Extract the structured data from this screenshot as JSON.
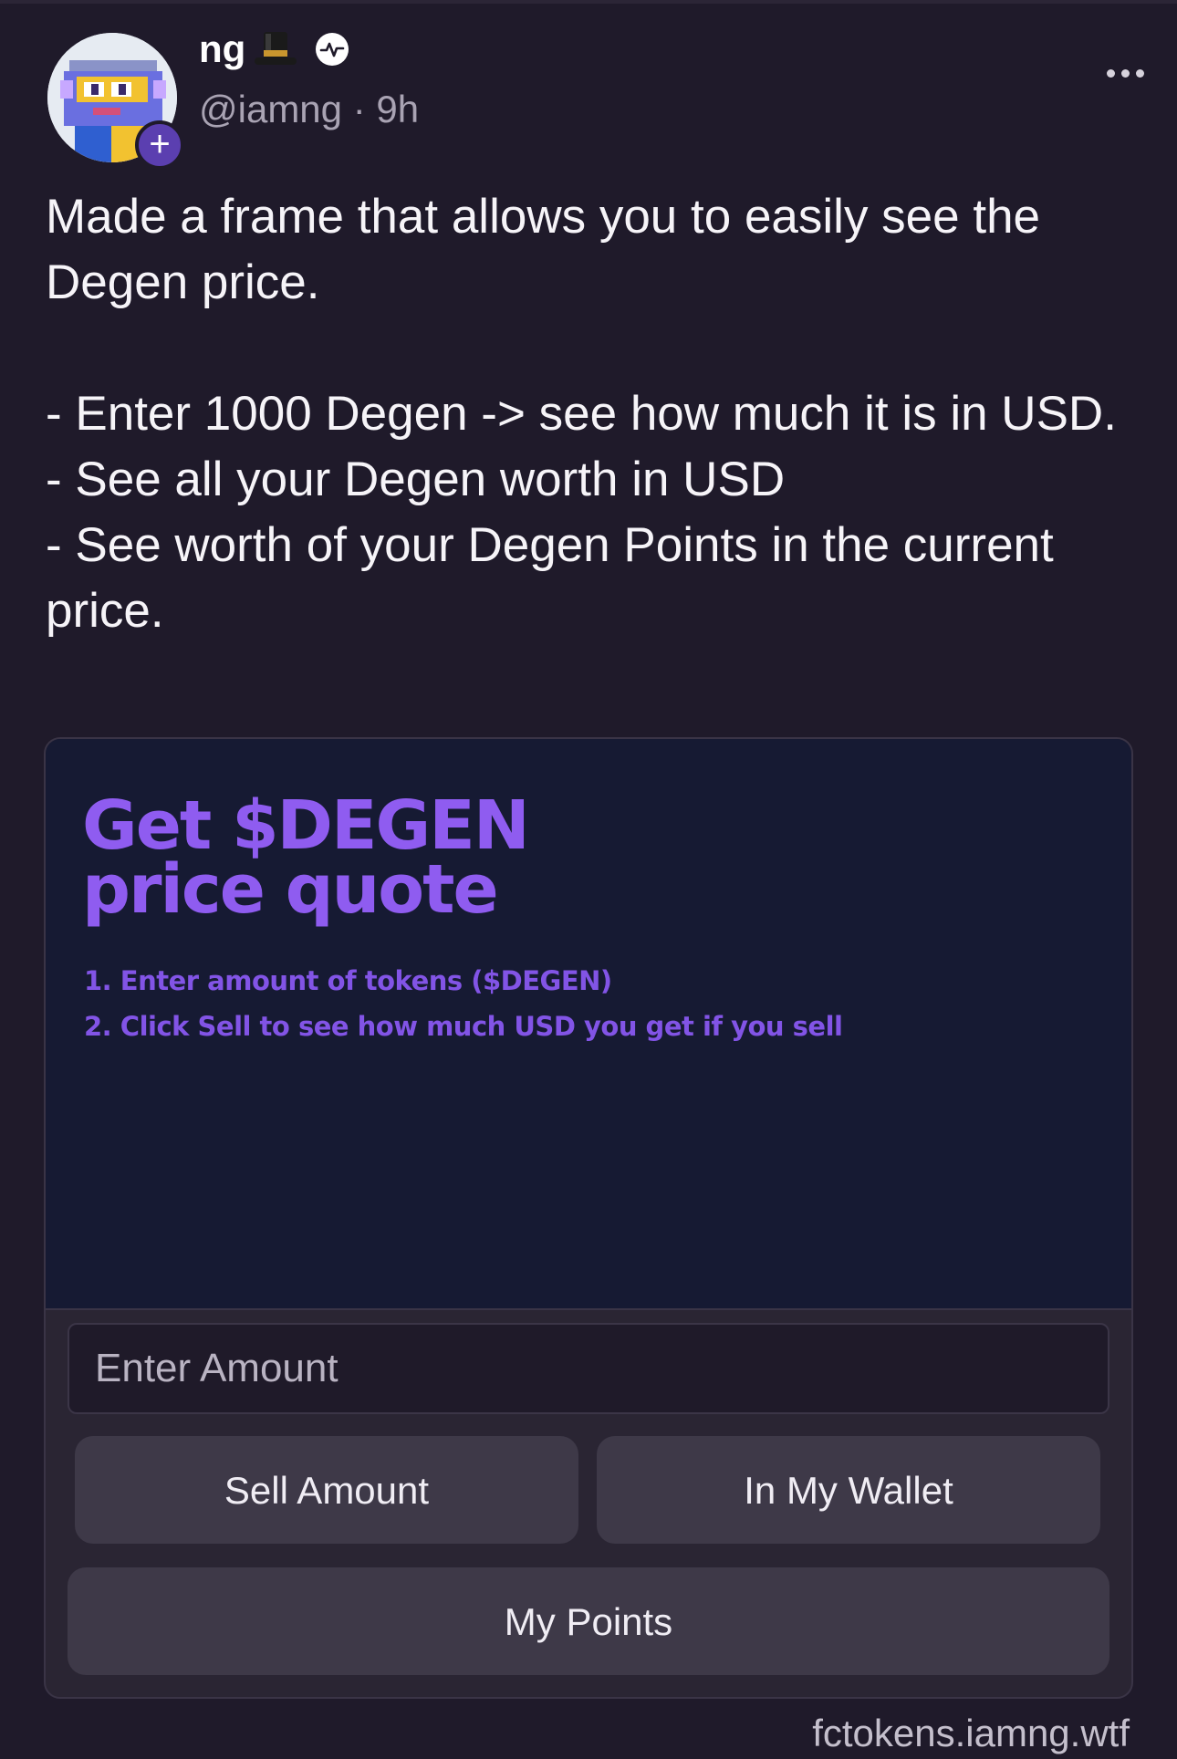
{
  "post": {
    "author": {
      "display_name": "ng",
      "name_emoji_icon": "top-hat-icon",
      "badge_icon": "power-badge-icon",
      "handle_time": "@iamng · 9h",
      "avatar_icon": "pixel-character-avatar",
      "follow_symbol": "+"
    },
    "more_icon": "more-horizontal-icon",
    "text": {
      "line1": "Made a frame that allows you to easily see the Degen price.",
      "line2": "- Enter 1000 Degen -> see how much it is in USD.",
      "line3": "- See all your Degen worth in USD",
      "line4": "- See worth of your Degen Points in the current price."
    }
  },
  "frame": {
    "title_line1": "Get $DEGEN",
    "title_line2": "price quote",
    "step1": "1. Enter amount of tokens ($DEGEN)",
    "step2": "2. Click Sell to see how much USD you get if you sell",
    "input_placeholder": "Enter Amount",
    "buttons": {
      "sell": "Sell Amount",
      "wallet": "In My Wallet",
      "points": "My Points"
    },
    "domain": "fctokens.iamng.wtf"
  },
  "colors": {
    "background": "#1f1a2a",
    "frame_image_bg": "#161a33",
    "accent_purple": "#8f5cf0",
    "button_bg": "#3e3948"
  }
}
